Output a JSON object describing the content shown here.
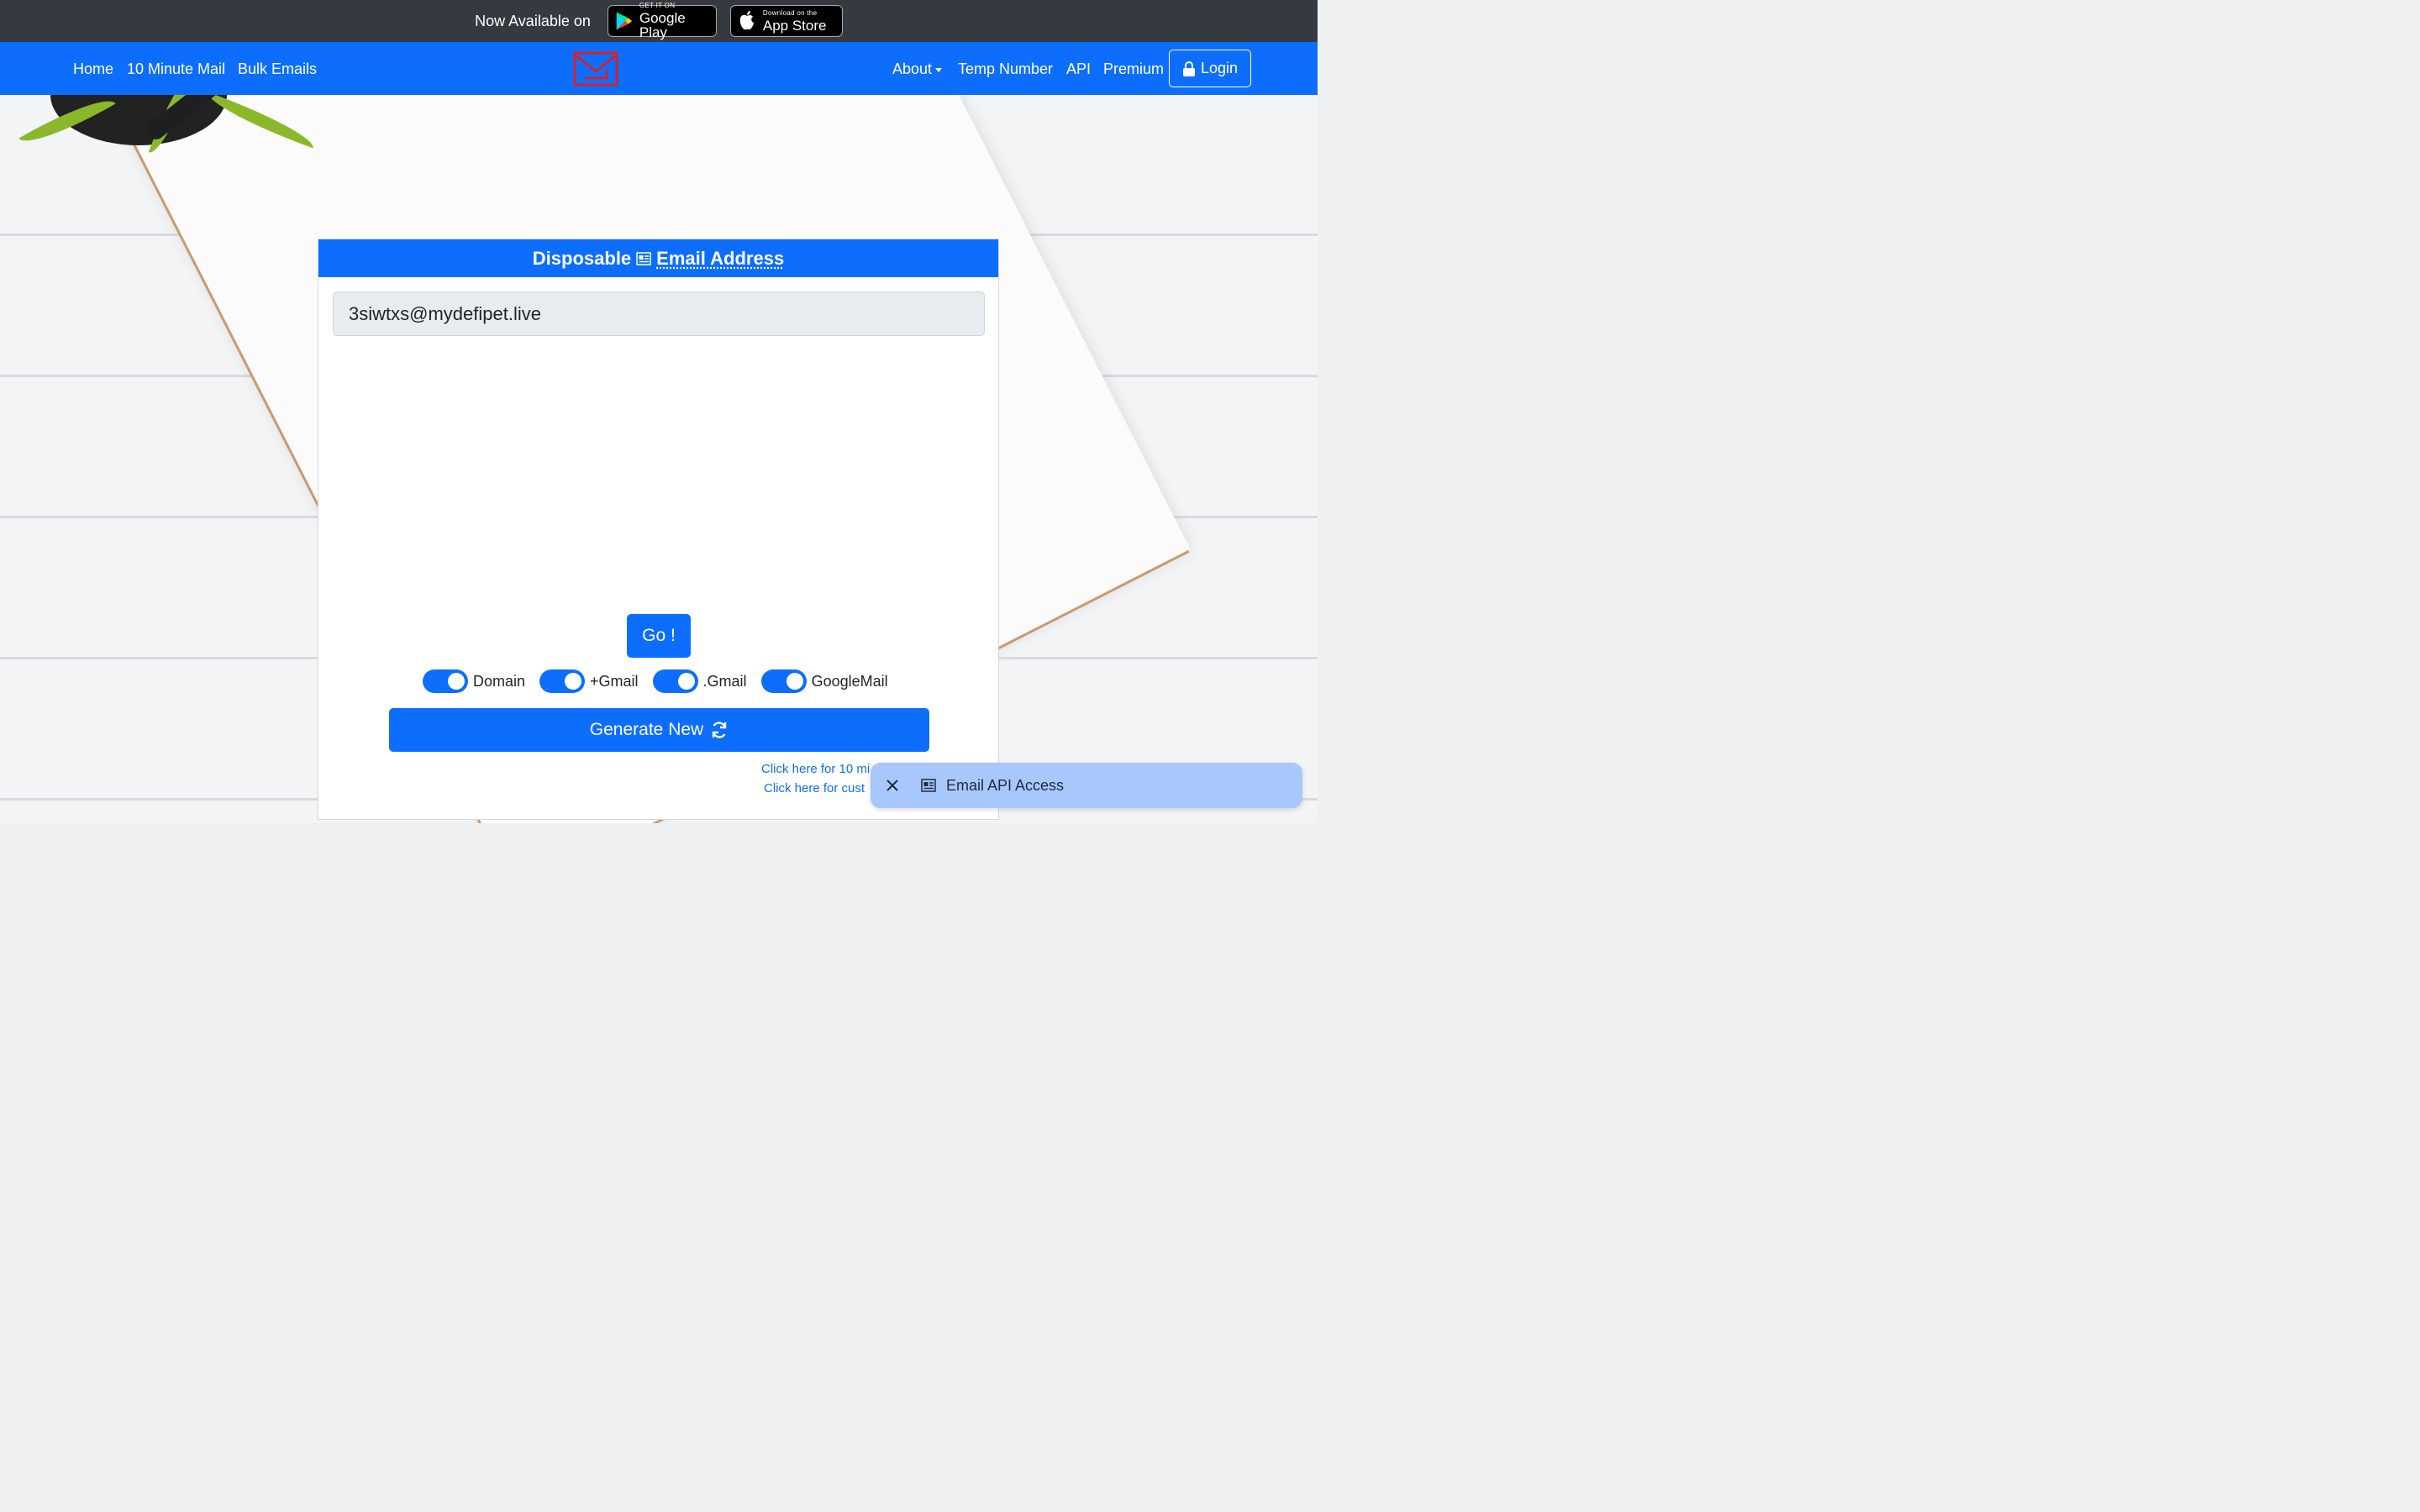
{
  "promo": {
    "text": "Now Available on",
    "google_play": {
      "small": "GET IT ON",
      "big": "Google Play"
    },
    "app_store": {
      "small": "Download on the",
      "big": "App Store"
    }
  },
  "nav": {
    "left": [
      "Home",
      "10 Minute Mail",
      "Bulk Emails"
    ],
    "about": "About",
    "temp_number": "Temp Number",
    "api": "API",
    "premium": "Premium",
    "login": "Login"
  },
  "card": {
    "title_prefix": "Disposable",
    "title_abbr": "Email Address",
    "email": "3siwtxs@mydefipet.live",
    "go": "Go !",
    "toggles": [
      "Domain",
      "+Gmail",
      ".Gmail",
      "GoogleMail"
    ],
    "generate": "Generate New",
    "link1": "Click here for 10 mi",
    "link2": "Click here for cust"
  },
  "toast": {
    "label": "Email API Access"
  },
  "colors": {
    "primary": "#0d6efd",
    "promo_bg": "#343a40",
    "toast_bg": "#a8c7fa"
  }
}
